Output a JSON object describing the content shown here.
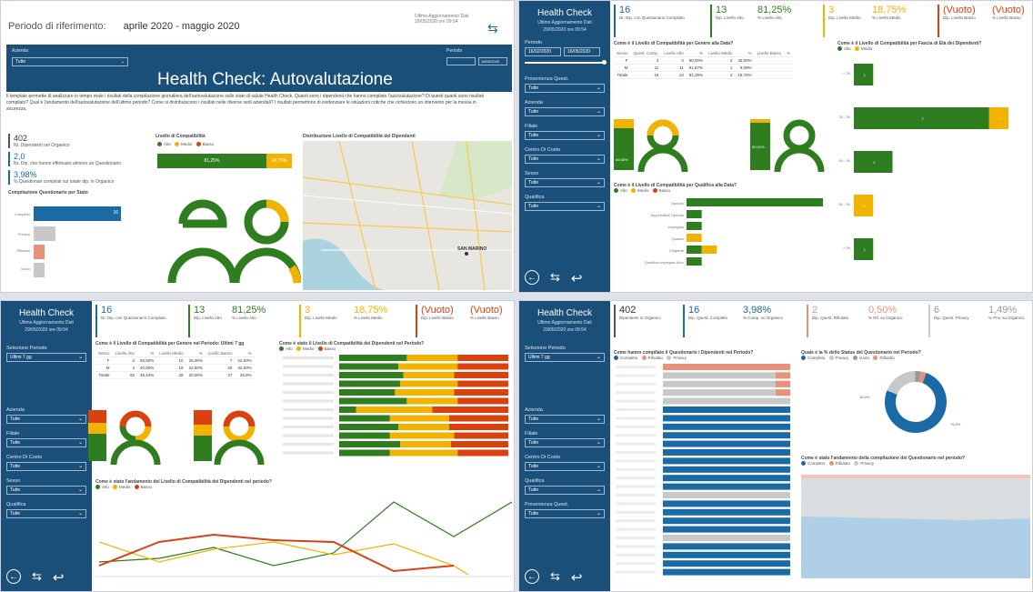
{
  "colors": {
    "green": "#2e7d1e",
    "yellow": "#f2b300",
    "red": "#d9420f",
    "blue": "#1a6aa6",
    "navy": "#1a4f7a",
    "grey": "#c8c8c8",
    "pink": "#e9907a"
  },
  "p1": {
    "period_label": "Periodo di riferimento:",
    "period_value": "aprile 2020 - maggio 2020",
    "last_update_label": "Ultimo Aggiornamento Dati",
    "last_update_value": "29/05/2020 ore 09:54",
    "azienda_label": "Azienda",
    "azienda_value": "Tutte",
    "periodo_label": "Periodo",
    "periodo_value": "16/02/2020",
    "title": "Health Check: Autovalutazione",
    "description": "Il template permette di analizzare in tempo reale i risultati della compilazione giornaliera dell'autovalutazione sullo stato di salute Health Check. Quanti sono i dipendenti che hanno compilato l'autovalutazione? Di questi quanti sono risultati compilato? Qual è l'andamento dell'autovalutazione dell'ultimo periodo? Come si distribuiscono i risultati nelle diverse sedi aziendali? I risultati permettono di evidenziare le situazioni critiche che richiedono un intervento per la messa in sicurezza.",
    "kpi1_value": "402",
    "kpi1_label": "Nr. Dipendenti nel Organico",
    "kpi2_value": "2,0",
    "kpi2_label": "Nr. Dip. che hanno effettuato almeno un Questionario",
    "kpi3_value": "3,98%",
    "kpi3_label": "% Questionari compilati sul totale dip. in Organico",
    "compilation_title": "Compilazione Questionario per Stato",
    "compilation_rows": [
      "Completo",
      "Privacy",
      "Rifiutato",
      "Vuoto"
    ],
    "compilation_value": "16",
    "level_title": "Livello di Compatibilità",
    "legend": [
      "Alto",
      "Medio",
      "Basso"
    ],
    "level_green": "81,25%",
    "level_yellow": "18,75%",
    "map_title": "Distribuzione Livello di Compatibilità dei Dipendenti",
    "map_city": "SAN MARINO"
  },
  "p2": {
    "app_title": "Health Check",
    "update_label": "Ultimo Aggiornamento Dati",
    "update_value": "29/05/2020 ore 09:54",
    "periodo_label": "Periodo",
    "periodo_from": "16/02/2020",
    "periodo_to": "16/05/2020",
    "filters": [
      {
        "label": "Provenienza Quest.",
        "value": "Tutte"
      },
      {
        "label": "Azienda",
        "value": "Tutte"
      },
      {
        "label": "Filiale",
        "value": "Tutte"
      },
      {
        "label": "Centro Di Costo",
        "value": "Tutte"
      },
      {
        "label": "Sesso",
        "value": "Tutte"
      },
      {
        "label": "Qualifica",
        "value": "Tutte"
      }
    ],
    "kpis": [
      {
        "value": "16",
        "label": "Nr. Dip. con Questionario Compilato"
      },
      {
        "value": "13",
        "label": "Dip. Livello Alto"
      },
      {
        "value": "81,25%",
        "label": "% Livello Alto"
      },
      {
        "value": "3",
        "label": "Dip. Livello Medio"
      },
      {
        "value": "18,75%",
        "label": "% Livello Medio"
      },
      {
        "value": "(Vuoto)",
        "label": "Dip. Livello Basso"
      },
      {
        "value": "(Vuoto)",
        "label": "% Livello Basso"
      }
    ],
    "table_title": "Come è il Livello di Compatibilità per Genere alla Data?",
    "table_headers": [
      "Sesso",
      "Quest. Comp.",
      "Livello Alto",
      "%",
      "Livello Medio",
      "%",
      "Livello Basso",
      "%"
    ],
    "table_rows": [
      [
        "F",
        "3",
        "3",
        "50,00%",
        "2",
        "40,00%",
        "",
        ""
      ],
      [
        "M",
        "11",
        "11",
        "91,67%",
        "1",
        "9,09%",
        "",
        ""
      ],
      [
        "Totale",
        "16",
        "13",
        "81,25%",
        "3",
        "18,75%",
        "",
        ""
      ]
    ],
    "fascia_title": "Come è il Livello di Compatibilità per Fascia di Età dei Dipendenti?",
    "fascia_legend": [
      "Alto",
      "Medio"
    ],
    "fascia_categories": [
      "< 30",
      "30 - 39",
      "40 - 49",
      "50 - 59",
      "> 59"
    ],
    "fascia_green": [
      1,
      7,
      2,
      0,
      1
    ],
    "fascia_yellow": [
      0,
      1,
      0,
      1,
      0
    ],
    "woman_green": "66,66%",
    "man_green": "90,91%",
    "qualifica_title": "Come è il Livello di Compatibilità per Qualifica alla Data?",
    "qualifica_legend": [
      "Alto",
      "Medio",
      "Basso"
    ],
    "qualifica_categories": [
      "Operaio",
      "Apprendista Operaio",
      "Impiegato",
      "Quadro",
      "Dirigente",
      "Qualifica Impiegato Altro"
    ],
    "qualifica_green": [
      9,
      1,
      1,
      0,
      1,
      1
    ],
    "qualifica_yellow": [
      0,
      0,
      0,
      1,
      1,
      0
    ]
  },
  "p3": {
    "app_title": "Health Check",
    "update_label": "Ultimo Aggiornamento Dati",
    "update_value": "29/05/2020 ore 09:54",
    "periodo_label": "Selezione Periodo",
    "periodo_value": "Ultimi 7 gg",
    "filters": [
      {
        "label": "Azienda",
        "value": "Tutte"
      },
      {
        "label": "Filiale",
        "value": "Tutte"
      },
      {
        "label": "Centro Di Costo",
        "value": "Tutte"
      },
      {
        "label": "Sesso",
        "value": "Tutte"
      },
      {
        "label": "Qualifica",
        "value": "Tutte"
      }
    ],
    "kpis": [
      {
        "value": "16",
        "label": "Nr. Dip. con Questionario Compilato"
      },
      {
        "value": "13",
        "label": "Dip. Livello Alto"
      },
      {
        "value": "81,25%",
        "label": "% Livello Alto"
      },
      {
        "value": "3",
        "label": "Dip. Livello Medio"
      },
      {
        "value": "18,75%",
        "label": "% Livello Medio"
      },
      {
        "value": "(Vuoto)",
        "label": "Dip. Livello Basso"
      },
      {
        "value": "(Vuoto)",
        "label": "% Livello Basso"
      }
    ],
    "table_title": "Come è il Livello di Compatibilità per Genere nel Periodo: Ultimi 7 gg",
    "table_headers": [
      "Sesso",
      "Livello Alto",
      "%",
      "Livello Medio",
      "%",
      "Livello Basso",
      "%"
    ],
    "table_rows": [
      [
        "F",
        "2",
        "50,50%",
        "10",
        "25,00%",
        "7",
        "22,50%"
      ],
      [
        "M",
        "4",
        "40,00%",
        "18",
        "22,50%",
        "26",
        "32,50%"
      ],
      [
        "Totale",
        "62",
        "45,44%",
        "28",
        "20,00%",
        "37",
        "25,9%"
      ]
    ],
    "stack_title": "Come è stato il Livello di Compatibilità dei Dipendenti nel Periodo?",
    "stack_legend": [
      "Alto",
      "Medio",
      "Basso"
    ],
    "trend_title": "Come è stato l'andamento del Livello di Compatibilità dei Dipendenti nel periodo?",
    "trend_legend": [
      "Alto",
      "Medio",
      "Basso"
    ]
  },
  "p4": {
    "app_title": "Health Check",
    "update_label": "Ultimo Aggiornamento Dati",
    "update_value": "29/05/2020 ore 09:54",
    "periodo_label": "Selezione Periodo",
    "periodo_value": "Ultimi 7 gg",
    "filters": [
      {
        "label": "Azienda",
        "value": "Tutte"
      },
      {
        "label": "Filiale",
        "value": "Tutte"
      },
      {
        "label": "Centro Di Costo",
        "value": "Tutte"
      },
      {
        "label": "Qualifica",
        "value": "Tutte"
      },
      {
        "label": "Provenienza Quest.",
        "value": "Tutte"
      }
    ],
    "kpis": [
      {
        "value": "402",
        "label": "Dipendenti in Organico"
      },
      {
        "value": "16",
        "label": "Dip. Quest. Completo"
      },
      {
        "value": "3,98%",
        "label": "% Comp. su Organico"
      },
      {
        "value": "2",
        "label": "Dip. Quest. Rifiutato"
      },
      {
        "value": "0,50%",
        "label": "% Rif. su Organico"
      },
      {
        "value": "6",
        "label": "Dip. Quest. Privacy"
      },
      {
        "value": "1,49%",
        "label": "% Priv. su Organico"
      }
    ],
    "list_title": "Come hanno compilato il Questionario i Dipendenti nel Periodo?",
    "list_legend": [
      "Completo",
      "Rifiutato",
      "Privacy"
    ],
    "donut_title": "Quale è la % dello Status del Questionario nel Periodo?",
    "donut_legend": [
      "Completo",
      "Privacy",
      "Vuoto",
      "Rifiutato"
    ],
    "donut_values": [
      75.5,
      18.6,
      3,
      2.9
    ],
    "donut_label_big": "75,5%",
    "donut_label_small": "18,6%",
    "area_title": "Come è stato l'andamento della compilazione del Questionario nel periodo?",
    "area_legend": [
      "Completo",
      "Rifiutato",
      "Privacy"
    ]
  }
}
